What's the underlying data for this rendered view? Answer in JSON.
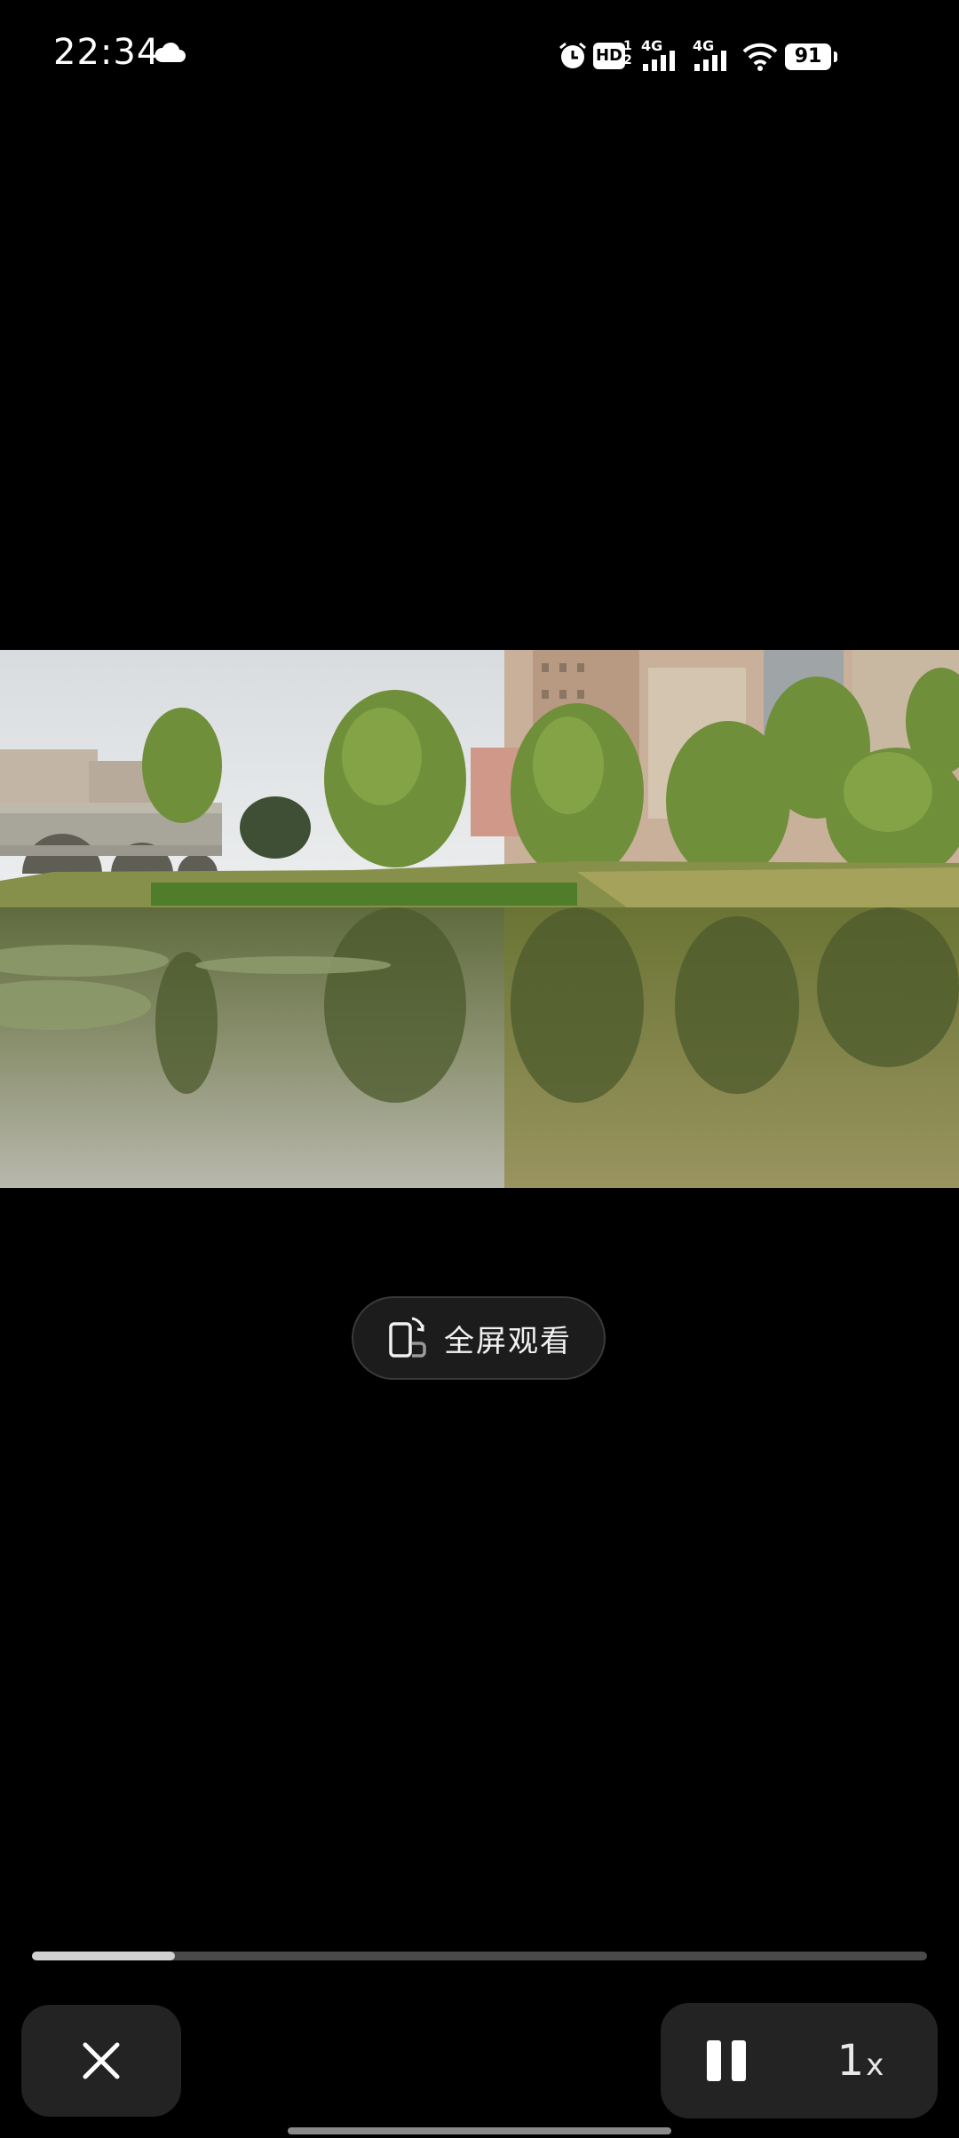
{
  "status_bar": {
    "time": "22:34",
    "weather_icon": "cloud-icon",
    "hd_label": "HD",
    "network_1": "4G",
    "network_2": "4G",
    "battery": "91"
  },
  "video": {
    "scene": "lake-park-bridge",
    "fullscreen_label": "全屏观看"
  },
  "player": {
    "progress_fraction": 0.16,
    "speed_value": "1",
    "speed_unit": "x",
    "close_icon": "close-icon",
    "pause_icon": "pause-icon"
  }
}
